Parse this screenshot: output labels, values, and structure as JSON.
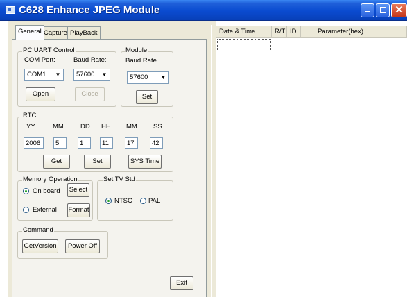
{
  "window": {
    "title": "C628 Enhance JPEG Module"
  },
  "tabs": [
    {
      "label": "General",
      "active": true
    },
    {
      "label": "Capture",
      "active": false
    },
    {
      "label": "PlayBack",
      "active": false
    }
  ],
  "uart": {
    "title": "PC UART Control",
    "com_port_label": "COM Port:",
    "com_port_value": "COM1",
    "baud_label": "Baud Rate:",
    "baud_value": "57600",
    "open_label": "Open",
    "close_label": "Close"
  },
  "module": {
    "title": "Module",
    "baud_label": "Baud Rate",
    "baud_value": "57600",
    "set_label": "Set"
  },
  "rtc": {
    "title": "RTC",
    "labels": [
      "YY",
      "MM",
      "DD",
      "HH",
      "MM",
      "SS"
    ],
    "values": [
      "2006",
      "5",
      "1",
      "11",
      "17",
      "42"
    ],
    "get_label": "Get",
    "set_label": "Set",
    "systime_label": "SYS Time"
  },
  "memory": {
    "title": "Memory Operation",
    "onboard_label": "On board",
    "external_label": "External",
    "selected": "On board",
    "select_label": "Select",
    "format_label": "Format"
  },
  "tvstd": {
    "title": "Set TV Std",
    "ntsc_label": "NTSC",
    "pal_label": "PAL",
    "selected": "NTSC"
  },
  "command": {
    "title": "Command",
    "getversion_label": "GetVersion",
    "poweroff_label": "Power Off"
  },
  "exit_label": "Exit",
  "log": {
    "columns": [
      "Date & Time",
      "R/T",
      "ID",
      "Parameter(hex)"
    ]
  },
  "icons": {
    "minimize": "minimize-icon",
    "maximize": "maximize-icon",
    "close": "close-icon",
    "dropdown": "chevron-down-icon"
  },
  "colors": {
    "titlebar": "#0a4bd0",
    "close_button": "#c4361a",
    "dialog_bg": "#ece9d8",
    "radio_dot": "#21a121"
  }
}
